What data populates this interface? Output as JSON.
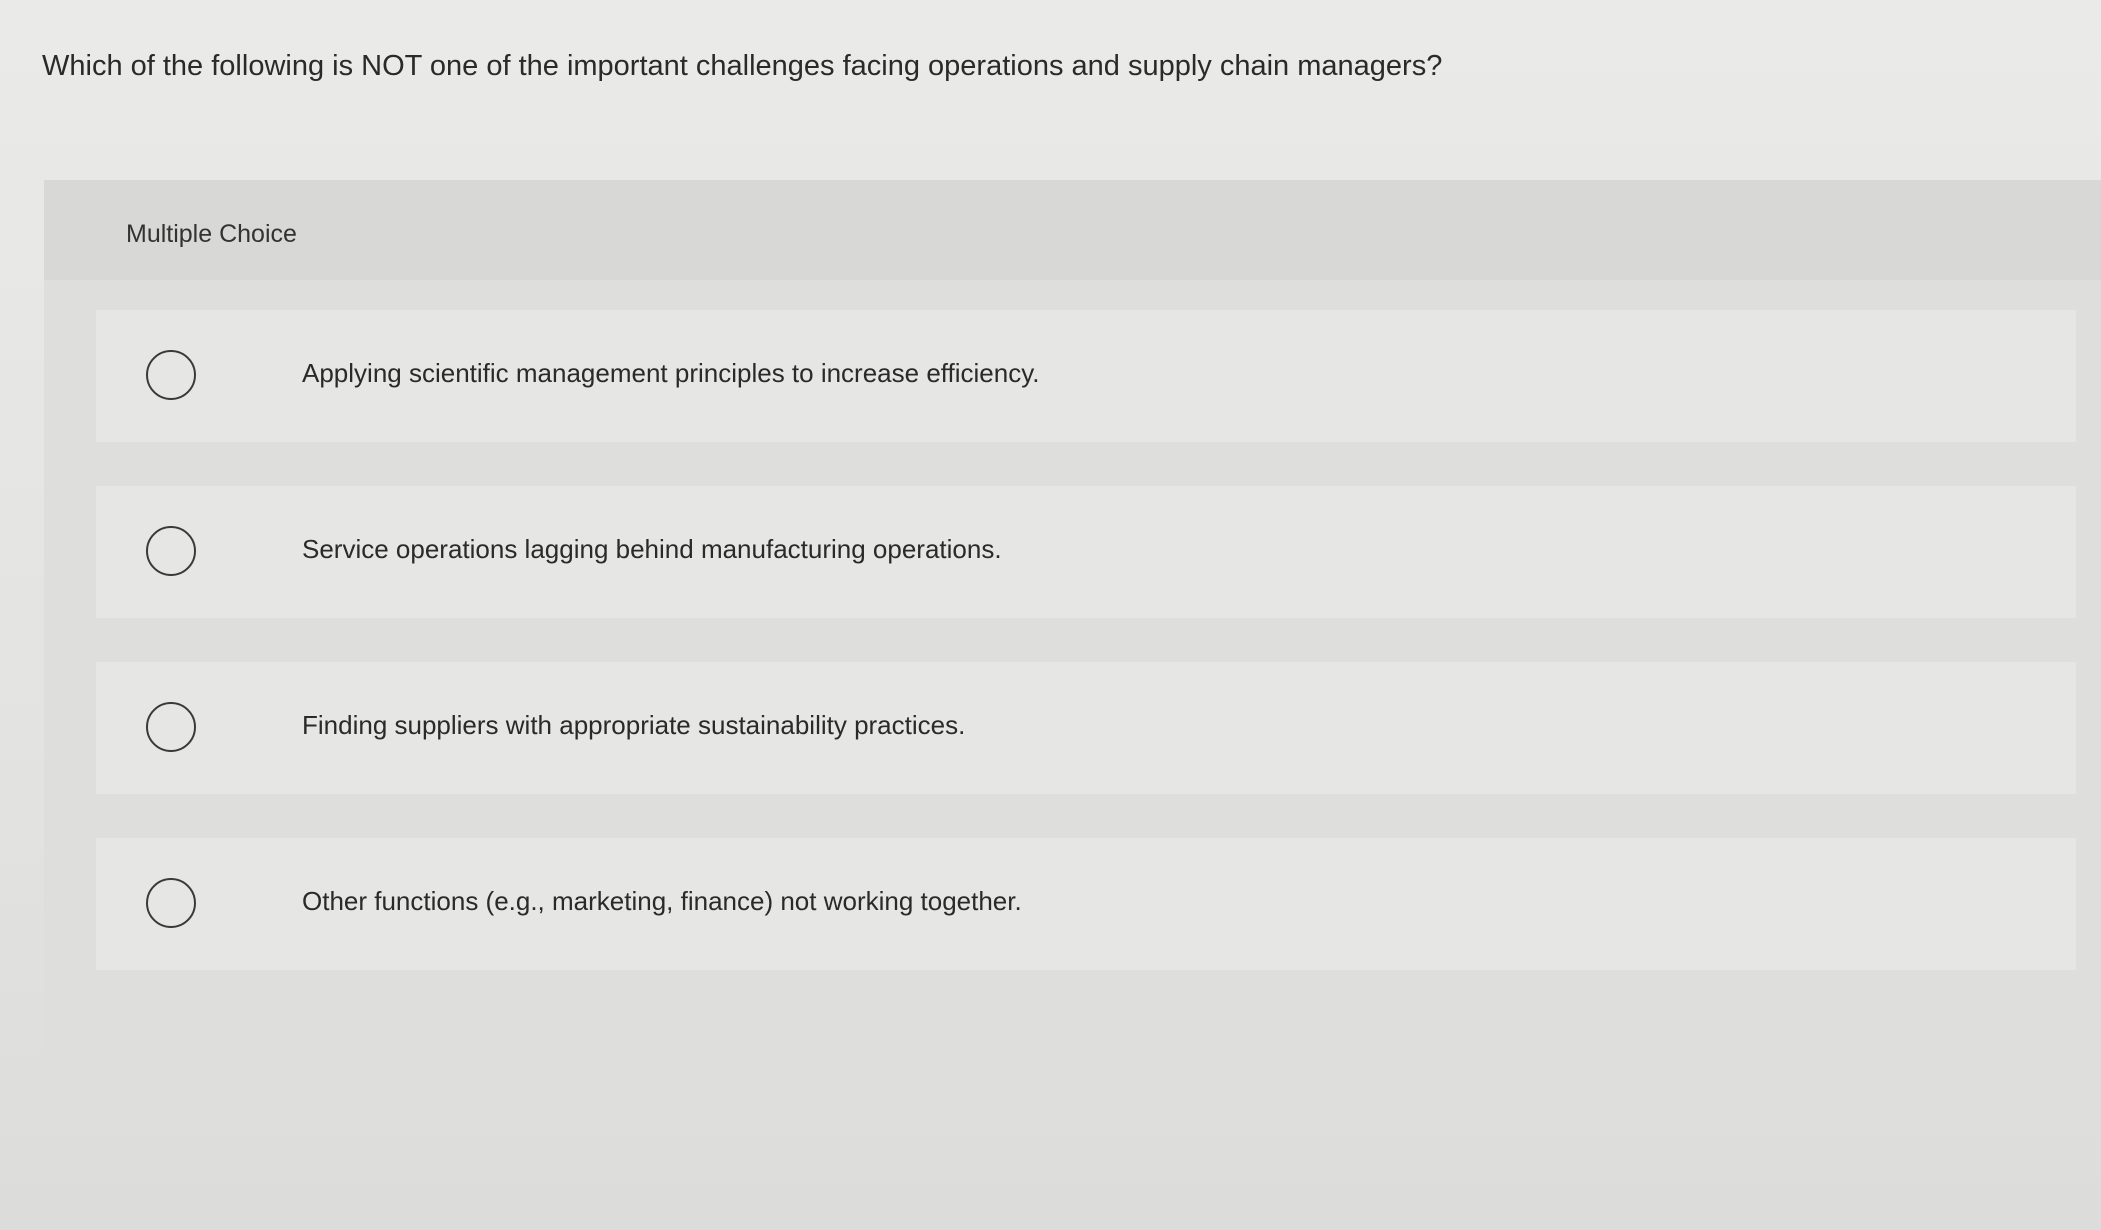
{
  "question": {
    "text": "Which of the following is NOT one of the important challenges facing operations and supply chain managers?"
  },
  "multiple_choice": {
    "label": "Multiple Choice",
    "options": [
      {
        "text": "Applying scientific management principles to increase efficiency.",
        "selected": false
      },
      {
        "text": "Service operations lagging behind manufacturing operations.",
        "selected": false
      },
      {
        "text": "Finding suppliers with appropriate sustainability practices.",
        "selected": false
      },
      {
        "text": "Other functions (e.g., marketing, finance) not working together.",
        "selected": false
      }
    ]
  },
  "colors": {
    "page_background": "#e6e6e4",
    "panel_background": "#dededc",
    "option_background": "#e6e6e4",
    "text": "#2a2a2a",
    "radio_border": "#3a3a3a"
  }
}
